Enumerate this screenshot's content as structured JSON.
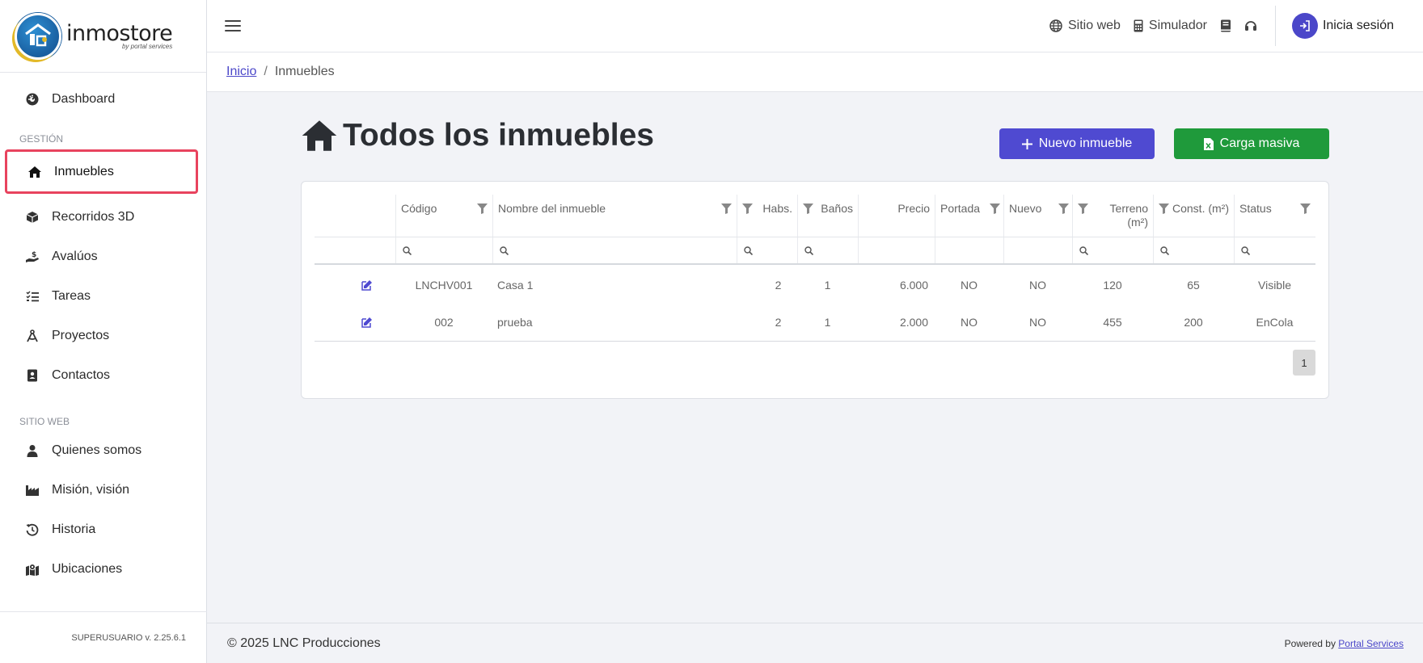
{
  "brand": {
    "name": "inmostore",
    "tagline": "by portal services"
  },
  "header": {
    "links": [
      {
        "label": "Sitio web",
        "icon": "globe-icon"
      },
      {
        "label": "Simulador",
        "icon": "calculator-icon"
      }
    ],
    "login_label": "Inicia sesión"
  },
  "breadcrumb": {
    "home": "Inicio",
    "current": "Inmuebles"
  },
  "sidebar": {
    "dashboard": "Dashboard",
    "section_gestion": "GESTIÓN",
    "gestion": [
      "Inmuebles",
      "Recorridos 3D",
      "Avalúos",
      "Tareas",
      "Proyectos",
      "Contactos"
    ],
    "section_sitio": "SITIO WEB",
    "sitio": [
      "Quienes somos",
      "Misión, visión",
      "Historia",
      "Ubicaciones"
    ],
    "version": "SUPERUSUARIO v. 2.25.6.1"
  },
  "page": {
    "title": "Todos los inmuebles",
    "new_button": "Nuevo inmueble",
    "bulk_button": "Carga masiva"
  },
  "table": {
    "columns": [
      "Código",
      "Nombre del inmueble",
      "Habs.",
      "Baños",
      "Precio",
      "Portada",
      "Nuevo",
      "Terreno (m²)",
      "Const. (m²)",
      "Status"
    ],
    "rows": [
      [
        "LNCHV001",
        "Casa 1",
        "2",
        "1",
        "6.000",
        "NO",
        "NO",
        "120",
        "65",
        "Visible"
      ],
      [
        "002",
        "prueba",
        "2",
        "1",
        "2.000",
        "NO",
        "NO",
        "455",
        "200",
        "EnCola"
      ]
    ],
    "page": "1"
  },
  "footer": {
    "copyright": "© 2025 LNC Producciones",
    "powered_prefix": "Powered by",
    "powered_link": "Portal Services"
  },
  "colors": {
    "primary": "#4f4ad1",
    "success": "#1f9a3b",
    "highlight": "#e8435e"
  }
}
